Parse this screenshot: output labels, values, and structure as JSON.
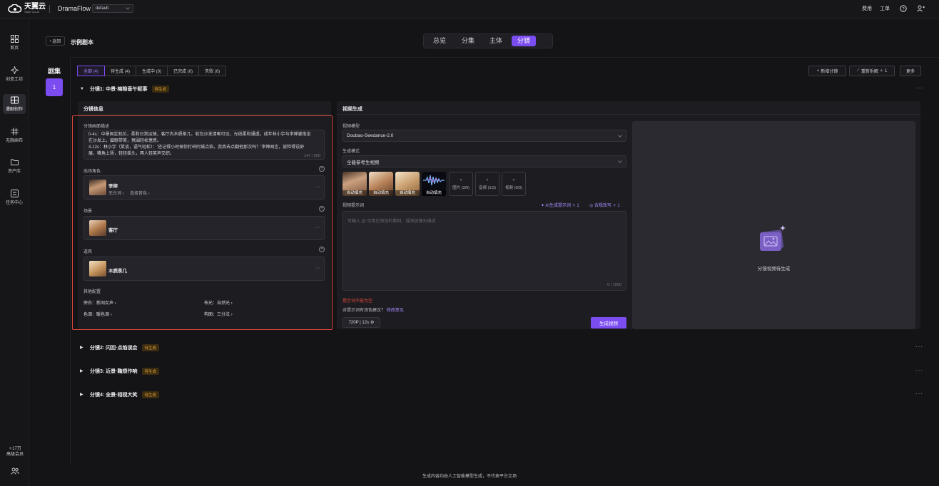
{
  "topbar": {
    "logo_text": "天翼云",
    "logo_sub": "State Cloud",
    "app_name": "DramaFlow",
    "workspace": "default",
    "right_items": [
      "费用",
      "工单"
    ]
  },
  "sidebar": {
    "items": [
      {
        "label": "首页",
        "icon": "grid-icon"
      },
      {
        "label": "创意工坊",
        "icon": "sparkle-icon"
      },
      {
        "label": "漫剧创作",
        "icon": "film-book-icon",
        "active": true
      },
      {
        "label": "无限画布",
        "icon": "hash-canvas-icon"
      },
      {
        "label": "资产库",
        "icon": "folder-icon"
      },
      {
        "label": "任务中心",
        "icon": "task-icon"
      }
    ],
    "credits": "17万",
    "membership": "高级会员"
  },
  "header": {
    "back_label": "返回",
    "title": "示例剧本",
    "tabs": [
      "总览",
      "分集",
      "主体",
      "分镜"
    ],
    "active_tab": "分镜"
  },
  "episodes": {
    "label": "剧集",
    "items": [
      "1"
    ]
  },
  "filters": [
    "全部 (4)",
    "待生成 (4)",
    "生成中 (0)",
    "已完成 (0)",
    "失败 (0)"
  ],
  "toolbar": {
    "new_shot": "新增分镜",
    "resplit": "重新拆解",
    "resplit_cost": "1",
    "more": "更多"
  },
  "shots": [
    {
      "title": "分镜1: 中景·榕隙垂午昵事",
      "status": "待生成",
      "expanded": true
    },
    {
      "title": "分镜2: 闪回·点焰误会",
      "status": "待生成"
    },
    {
      "title": "分镜3: 近景·鞠烦作响",
      "status": "待生成"
    },
    {
      "title": "分镜4: 全景·相视大笑",
      "status": "待生成"
    }
  ],
  "shot_info": {
    "header": "分镜信息",
    "desc_label": "分镜画面描述",
    "desc_lines": [
      "0-4s：中景固定机位，柔和日常运镜，客厅内木质茶几、软包沙发清晰可见，光线柔和通透。成年林小宇与李婶婆抱坐",
      "在沙发上，眉眼带笑，氛围轻松惬意。",
      "4-12s：林小宇（笑谈，语气轻松）：'还记得小时候你打碎阿城点焰，我真去点翻他那次吗？'李婶闻言，放险得设舒",
      "展，嘴角上扬，轻轻摇头，两人轻笑声交织。"
    ],
    "desc_count": "147 / 500",
    "characters_label": "出场角色",
    "character_name": "李婶",
    "character_voice": "无台词",
    "character_tone": "选择音色",
    "scene_label": "场景",
    "scene_name": "客厅",
    "props_label": "道具",
    "prop_name": "木质茶几",
    "other_label": "其他配置",
    "other": [
      {
        "key": "旁白",
        "value": "新闻女声"
      },
      {
        "key": "布光",
        "value": "自然光"
      },
      {
        "key": "色调",
        "value": "暖色调"
      },
      {
        "key": "构图",
        "value": "三分法"
      }
    ]
  },
  "video_gen": {
    "header": "视频生成",
    "model_label": "视频模型",
    "model": "Doubao-Seedance-2.0",
    "mode_label": "生成模式",
    "mode": "全能参考生视频",
    "refs": [
      "自动填充",
      "自动填充",
      "自动填充",
      "自动填充"
    ],
    "add_buttons": [
      {
        "label": "图片",
        "count": "(3/9)"
      },
      {
        "label": "音频",
        "count": "(1/3)"
      },
      {
        "label": "视频",
        "count": "(0/3)"
      }
    ],
    "prompt_label": "视频提示词",
    "ai_prompt": "AI生成提示词",
    "ai_prompt_cost": "1",
    "compliance": "合规改写",
    "compliance_cost": "1",
    "prompt_placeholder": "可输入 @ 引用已添加的素材，或添加镜头描述",
    "prompt_count": "0 / 1500",
    "error": "提示词不能为空",
    "suggest_q": "对提示词有润色建议？",
    "suggest_link": "修改意见",
    "settings": "720P | 12s",
    "generate": "生成视频",
    "preview_text": "分镜视频待生成"
  },
  "footer": "生成内容均由人工智能模型生成，不代表平台立场",
  "colors": {
    "accent": "#7b4cf0",
    "pending": "#e0a030",
    "error": "#e0483a"
  }
}
